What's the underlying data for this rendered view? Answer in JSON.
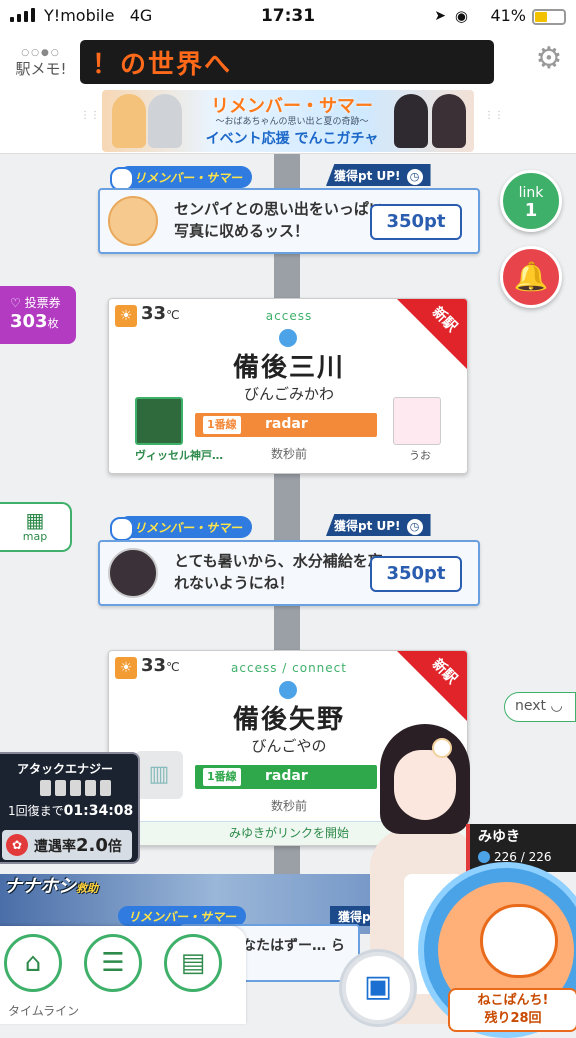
{
  "status_bar": {
    "carrier": "Y!mobile",
    "network": "4G",
    "time": "17:31",
    "battery": "41%"
  },
  "header": {
    "logo": "駅メモ!",
    "marquee": "！の世界へ",
    "banner": {
      "title": "リメンバー・サマー",
      "subtitle": "～おばあちゃんの思い出と夏の奇跡～",
      "bottom": "イベント応援 でんこガチャ"
    }
  },
  "event_tag": "リメンバー・サマー",
  "gain_tag": "獲得pt UP!",
  "missions": [
    {
      "text": "センパイとの思い出をいっぱい写真に収めるッス！",
      "pt": "350pt"
    },
    {
      "text": "とても暑いから、水分補給を忘れないようにね！",
      "pt": "350pt"
    }
  ],
  "stations": [
    {
      "temp": "33",
      "unit": "℃",
      "access": "access",
      "new_badge": "新駅",
      "name": "備後三川",
      "kana": "びんごみかわ",
      "line_no": "1番線",
      "line_label": "radar",
      "line_color": "#f38a3a",
      "ago": "数秒前",
      "me_name": "ヴィッセル神戸…",
      "other_name": "うお"
    },
    {
      "temp": "33",
      "unit": "℃",
      "access": "access / connect",
      "new_badge": "新駅",
      "name": "備後矢野",
      "kana": "びんごやの",
      "line_no": "1番線",
      "line_label": "radar",
      "line_color": "#2ea84a",
      "ago": "数秒前",
      "link_msg": "みゆきがリンクを開始"
    }
  ],
  "link_button": {
    "label": "link",
    "count": "1"
  },
  "vote": {
    "label": "投票券",
    "count": "303",
    "unit": "枚"
  },
  "map_label": "map",
  "next_label": "next",
  "energy": {
    "title": "アタックエナジー",
    "recovery_prefix": "1回復まで",
    "recovery_time": "01:34:08",
    "rate_label": "遭遇率",
    "rate_value": "2.0",
    "rate_unit": "倍"
  },
  "partner": {
    "name": "みゆき",
    "hp": "226 / 226"
  },
  "punch": {
    "line1": "ねこぱんち!",
    "line2": "残り28回"
  },
  "nanahon": {
    "title": "ナナホシ",
    "sub": "救助"
  },
  "bottom_mission_text": "するあなたはずー… られます",
  "tabbar": {
    "label": "タイムライン"
  }
}
